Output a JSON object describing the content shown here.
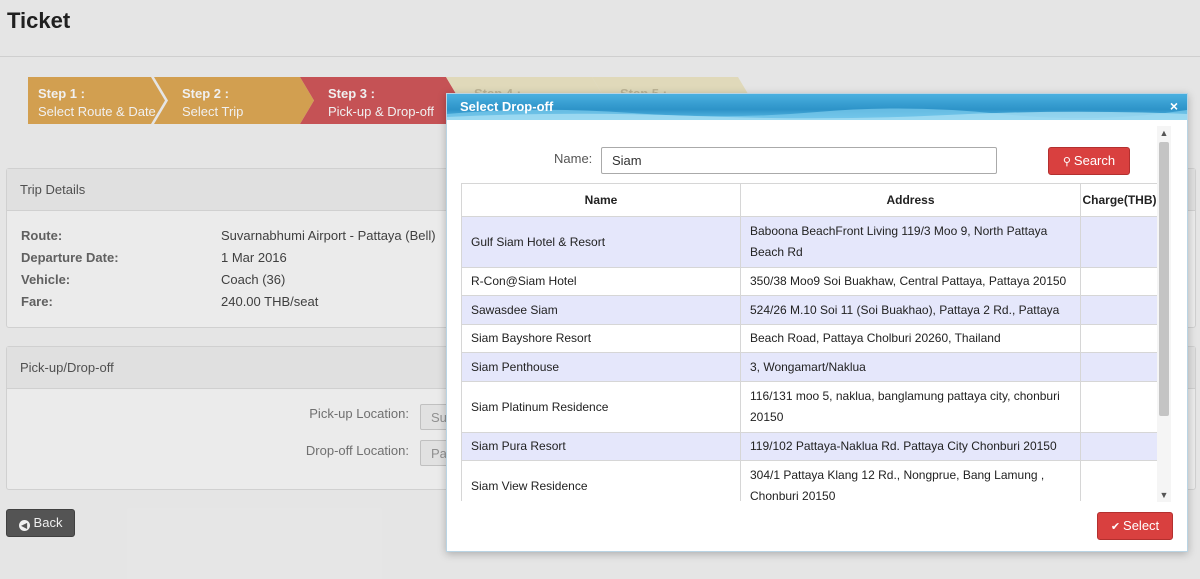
{
  "page": {
    "title": "Ticket"
  },
  "steps": [
    {
      "num": "Step 1 :",
      "label": "Select Route & Date"
    },
    {
      "num": "Step 2 :",
      "label": "Select Trip"
    },
    {
      "num": "Step 3 :",
      "label": "Pick-up & Drop-off"
    },
    {
      "num": "Step 4 :",
      "label": ""
    },
    {
      "num": "Step 5 :",
      "label": ""
    }
  ],
  "trip": {
    "heading": "Trip Details",
    "rows": [
      {
        "key": "Route:",
        "value": "Suvarnabhumi Airport - Pattaya (Bell)"
      },
      {
        "key": "Departure Date:",
        "value": "1 Mar 2016"
      },
      {
        "key": "Vehicle:",
        "value": "Coach (36)"
      },
      {
        "key": "Fare:",
        "value": "240.00 THB/seat"
      }
    ]
  },
  "pickdrop": {
    "heading": "Pick-up/Drop-off",
    "pickup_label": "Pick-up Location:",
    "pickup_value": "Su",
    "dropoff_label": "Drop-off Location:",
    "dropoff_value": "Pa"
  },
  "back_button": {
    "label": "Back",
    "icon": "arrow-left-circle-icon"
  },
  "modal": {
    "title": "Select Drop-off",
    "close": "×",
    "name_label": "Name:",
    "name_value": "Siam",
    "search_label": "Search",
    "search_icon": "search-icon",
    "select_label": "Select",
    "select_icon": "check-icon",
    "columns": [
      "Name",
      "Address",
      "Charge(THB)"
    ],
    "rows": [
      {
        "name": "Gulf Siam Hotel & Resort",
        "address": "Baboona BeachFront Living 119/3 Moo 9, North Pattaya Beach Rd",
        "charge": ""
      },
      {
        "name": "R-Con@Siam Hotel",
        "address": "350/38 Moo9 Soi Buakhaw, Central Pattaya, Pattaya 20150",
        "charge": ""
      },
      {
        "name": "Sawasdee Siam",
        "address": "524/26 M.10 Soi 11 (Soi Buakhao), Pattaya 2 Rd., Pattaya",
        "charge": ""
      },
      {
        "name": "Siam Bayshore Resort",
        "address": "Beach Road, Pattaya Cholburi 20260, Thailand",
        "charge": ""
      },
      {
        "name": "Siam Penthouse",
        "address": "3, Wongamart/Naklua",
        "charge": ""
      },
      {
        "name": "Siam Platinum Residence",
        "address": "116/131 moo 5, naklua, banglamung pattaya city, chonburi 20150",
        "charge": ""
      },
      {
        "name": "Siam Pura Resort",
        "address": "119/102  Pattaya-Naklua  Rd. Pattaya  City  Chonburi  20150",
        "charge": ""
      },
      {
        "name": "Siam View Residence",
        "address": "304/1 Pattaya Klang 12 Rd., Nongprue, Bang Lamung , Chonburi 20150",
        "charge": ""
      }
    ]
  }
}
